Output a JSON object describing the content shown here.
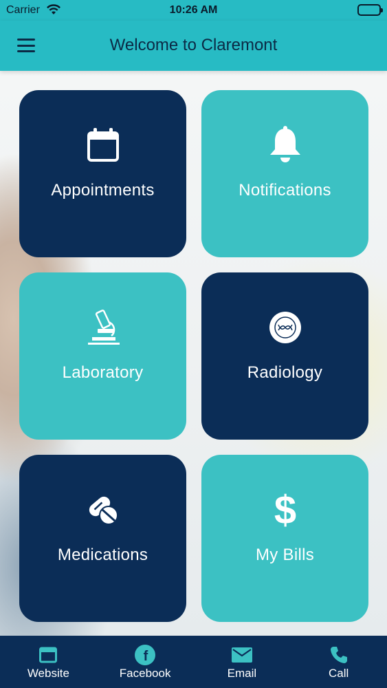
{
  "status_bar": {
    "carrier": "Carrier",
    "time": "10:26 AM"
  },
  "header": {
    "title": "Welcome to Claremont",
    "menu_icon": "hamburger-menu-icon"
  },
  "tiles": [
    {
      "label": "Appointments",
      "icon": "calendar-icon",
      "color": "#0b2d57"
    },
    {
      "label": "Notifications",
      "icon": "bell-icon",
      "color": "#3cc1c3"
    },
    {
      "label": "Laboratory",
      "icon": "microscope-icon",
      "color": "#3cc1c3"
    },
    {
      "label": "Radiology",
      "icon": "radiology-icon",
      "color": "#0b2d57"
    },
    {
      "label": "Medications",
      "icon": "pills-icon",
      "color": "#0b2d57"
    },
    {
      "label": "My Bills",
      "icon": "dollar-icon",
      "color": "#3cc1c3"
    }
  ],
  "tab_bar": [
    {
      "label": "Website",
      "icon": "browser-window-icon"
    },
    {
      "label": "Facebook",
      "icon": "facebook-icon"
    },
    {
      "label": "Email",
      "icon": "envelope-icon"
    },
    {
      "label": "Call",
      "icon": "phone-icon"
    }
  ],
  "colors": {
    "header": "#27bbc4",
    "dark_tile": "#0b2d57",
    "teal_tile": "#3cc1c3",
    "tab_bar": "#0b2d57",
    "tab_icon": "#3cc1c3"
  }
}
